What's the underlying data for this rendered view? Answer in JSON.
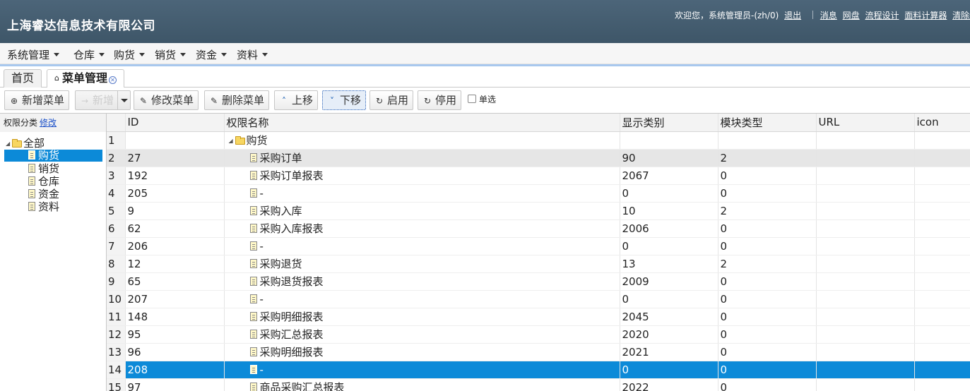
{
  "header": {
    "company": "上海睿达信息技术有限公司",
    "welcome": "欢迎您，系统管理员-(zh/0)",
    "logout": "退出",
    "links": [
      "消息",
      "网盘",
      "流程设计",
      "面料计算器",
      "清除缓存"
    ]
  },
  "menubar": {
    "items": [
      "系统管理",
      "仓库",
      "购货",
      "销货",
      "资金",
      "资料"
    ]
  },
  "tabs": [
    {
      "label": "首页"
    },
    {
      "label": "菜单管理"
    }
  ],
  "toolbar": {
    "add": "新增菜单",
    "add_split": "新增",
    "edit": "修改菜单",
    "delete": "删除菜单",
    "up": "上移",
    "down": "下移",
    "enable": "启用",
    "disable": "停用",
    "single": "单选"
  },
  "left_panel": {
    "title": "权限分类",
    "edit_link": "修改",
    "root": "全部",
    "children": [
      "购货",
      "销货",
      "仓库",
      "资金",
      "资料"
    ],
    "selected": "购货"
  },
  "grid": {
    "columns": [
      "ID",
      "权限名称",
      "显示类别",
      "模块类型",
      "URL",
      "icon"
    ],
    "rows": [
      {
        "n": "1",
        "id": "",
        "name": "购货",
        "show": "",
        "module": "",
        "folder": true
      },
      {
        "n": "2",
        "id": "27",
        "name": "采购订单",
        "show": "90",
        "module": "2",
        "state": "hover"
      },
      {
        "n": "3",
        "id": "192",
        "name": "采购订单报表",
        "show": "2067",
        "module": "0"
      },
      {
        "n": "4",
        "id": "205",
        "name": "-",
        "show": "0",
        "module": "0"
      },
      {
        "n": "5",
        "id": "9",
        "name": "采购入库",
        "show": "10",
        "module": "2"
      },
      {
        "n": "6",
        "id": "62",
        "name": "采购入库报表",
        "show": "2006",
        "module": "0"
      },
      {
        "n": "7",
        "id": "206",
        "name": "-",
        "show": "0",
        "module": "0"
      },
      {
        "n": "8",
        "id": "12",
        "name": "采购退货",
        "show": "13",
        "module": "2"
      },
      {
        "n": "9",
        "id": "65",
        "name": "采购退货报表",
        "show": "2009",
        "module": "0"
      },
      {
        "n": "10",
        "id": "207",
        "name": "-",
        "show": "0",
        "module": "0"
      },
      {
        "n": "11",
        "id": "148",
        "name": "采购明细报表",
        "show": "2045",
        "module": "0"
      },
      {
        "n": "12",
        "id": "95",
        "name": "采购汇总报表",
        "show": "2020",
        "module": "0"
      },
      {
        "n": "13",
        "id": "96",
        "name": "采购明细报表",
        "show": "2021",
        "module": "0"
      },
      {
        "n": "14",
        "id": "208",
        "name": "-",
        "show": "0",
        "module": "0",
        "state": "selected"
      },
      {
        "n": "15",
        "id": "97",
        "name": "商品采购汇总报表",
        "show": "2022",
        "module": "0"
      }
    ]
  }
}
